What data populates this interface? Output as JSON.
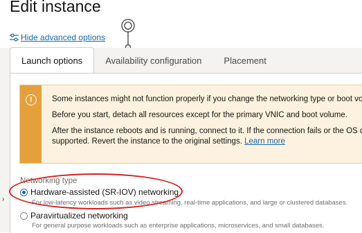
{
  "page": {
    "title": "Edit instance",
    "advanced_link": "Hide advanced options"
  },
  "icons": {
    "advanced": "sliders-icon",
    "warning": "info-circle-icon",
    "click_marker": "click-indicator-icon"
  },
  "colors": {
    "link": "#1a66ad",
    "warning_stripe": "#e4a03b",
    "warning_bg": "#fdf2df",
    "annotation": "#d8201c"
  },
  "tabs": [
    {
      "label": "Launch options",
      "active": true
    },
    {
      "label": "Availability configuration",
      "active": false
    },
    {
      "label": "Placement",
      "active": false
    }
  ],
  "warning": {
    "icon_glyph": "!",
    "line1": "Some instances might not function properly if you change the networking type or boot volum",
    "line2": "Before you start, detach all resources except for the primary VNIC and boot volume.",
    "line3": "After the instance reboots and is running, connect to it. If the connection fails or the OS does",
    "line4": "supported. Revert the instance to the original settings.",
    "link": "Learn more"
  },
  "networking": {
    "label": "Networking type",
    "options": [
      {
        "label": "Hardware-assisted (SR-IOV) networking",
        "description": "For low-latency workloads such as video streaming, real-time applications, and large or clustered databases.",
        "selected": true
      },
      {
        "label": "Paravirtualized networking",
        "description": "For general purpose workloads such as enterprise applications, microservices, and small databases.",
        "selected": false
      }
    ]
  },
  "side_marker": "›"
}
